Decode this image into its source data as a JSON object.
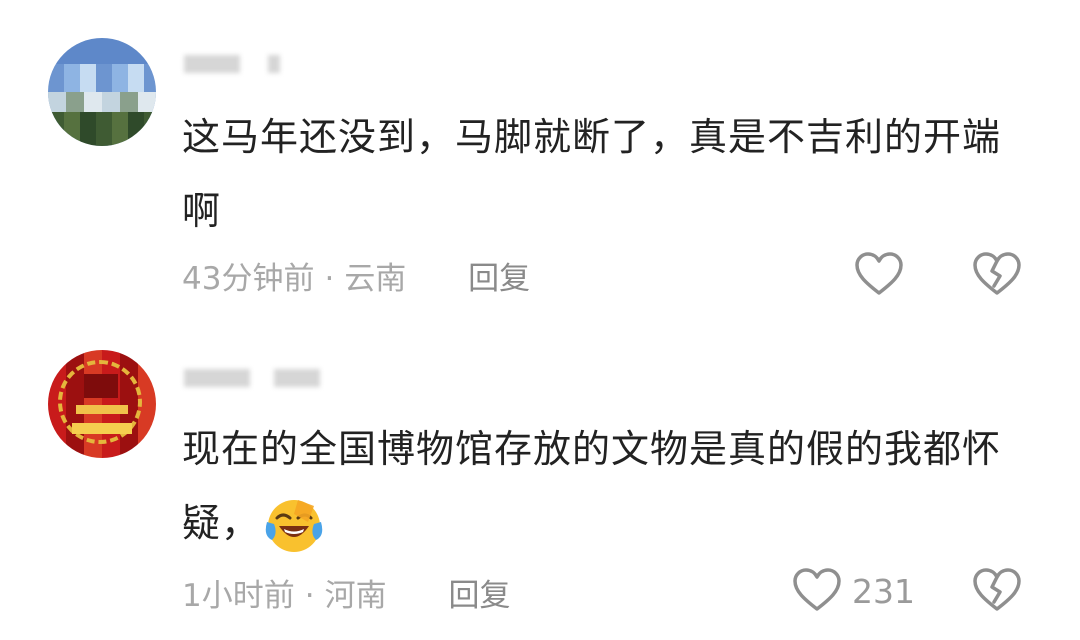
{
  "comments": [
    {
      "username": "•••••",
      "text": "这马年还没到，马脚就断了，真是不吉利的开端啊",
      "time": "43分钟前",
      "location": "云南",
      "reply_label": "回复",
      "like_count": "",
      "avatar_icon": "landscape-avatar"
    },
    {
      "username": "•••••",
      "text": "现在的全国博物馆存放的文物是真的假的我都怀疑，",
      "emoji": "crying-laughing-emoji",
      "time": "1小时前",
      "location": "河南",
      "reply_label": "回复",
      "like_count": "231",
      "avatar_icon": "emblem-avatar"
    }
  ],
  "separator": "·",
  "colors": {
    "text": "#222222",
    "meta": "#a8a8a8",
    "icon": "#8f8f8f"
  }
}
